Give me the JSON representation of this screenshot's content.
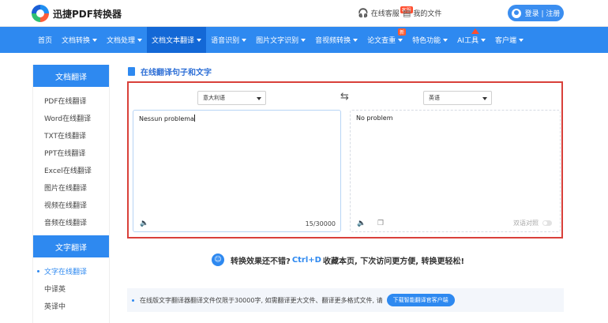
{
  "header": {
    "logo_text": "迅捷PDF转换器",
    "service_label": "在线客服",
    "service_badge": "客服",
    "my_files_label": "我的文件",
    "login_label": "登录 | 注册"
  },
  "nav": {
    "items": [
      {
        "label": "首页"
      },
      {
        "label": "文档转换"
      },
      {
        "label": "文档处理"
      },
      {
        "label": "文档文本翻译"
      },
      {
        "label": "语音识别"
      },
      {
        "label": "图片文字识别"
      },
      {
        "label": "音视频转换"
      },
      {
        "label": "论文查重",
        "badge": "新"
      },
      {
        "label": "特色功能"
      },
      {
        "label": "AI工具"
      },
      {
        "label": "客户端"
      }
    ]
  },
  "sidebar": {
    "section1_title": "文档翻译",
    "section1_items": [
      "PDF在线翻译",
      "Word在线翻译",
      "TXT在线翻译",
      "PPT在线翻译",
      "Excel在线翻译",
      "图片在线翻译",
      "视频在线翻译",
      "音频在线翻译"
    ],
    "section2_title": "文字翻译",
    "section2_items": [
      "文字在线翻译",
      "中译英",
      "英译中"
    ]
  },
  "main": {
    "title": "在线翻译句子和文字",
    "source_lang": "意大利语",
    "target_lang": "英语",
    "source_text": "Nessun problema",
    "target_text": "No problem",
    "char_count": "15/30000",
    "bilingual_label": "双语对照",
    "tip_prefix": "转换效果还不错?",
    "tip_hotkey": "Ctrl+D",
    "tip_suffix": "收藏本页, 下次访问更方便, 转换更轻松!",
    "notice_text": "在线版文字翻译器翻译文件仅限于30000字, 如需翻译更大文件、翻译更多格式文件, 请",
    "download_label": "下载智能翻译官客户端"
  }
}
